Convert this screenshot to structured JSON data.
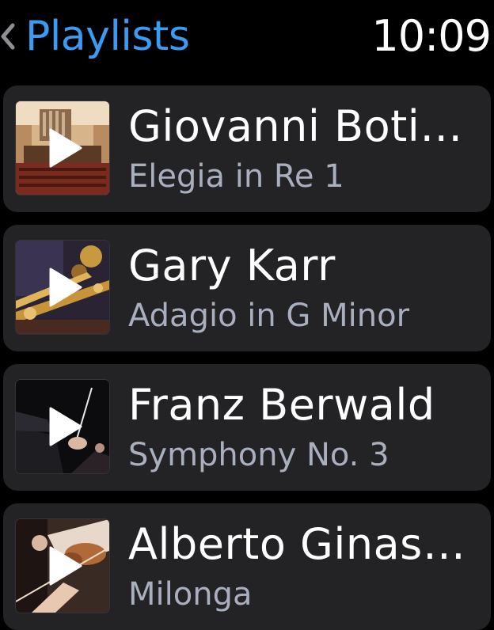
{
  "header": {
    "back_icon": "chevron-left-icon",
    "title": "Playlists",
    "time": "10:09"
  },
  "playlists": [
    {
      "artist": "Giovanni Boti…",
      "work": "Elegia in Re 1",
      "thumb": "concert-hall-orchestra"
    },
    {
      "artist": "Gary Karr",
      "work": "Adagio in G Minor",
      "thumb": "brass-instruments"
    },
    {
      "artist": "Franz Berwald",
      "work": "Symphony No. 3",
      "thumb": "conductor-baton"
    },
    {
      "artist": "Alberto Ginas…",
      "work": "Milonga",
      "thumb": "violinist-bow"
    }
  ],
  "colors": {
    "accent": "#3a9bf2",
    "card_bg": "#232325",
    "subtitle": "#a9afbd"
  }
}
